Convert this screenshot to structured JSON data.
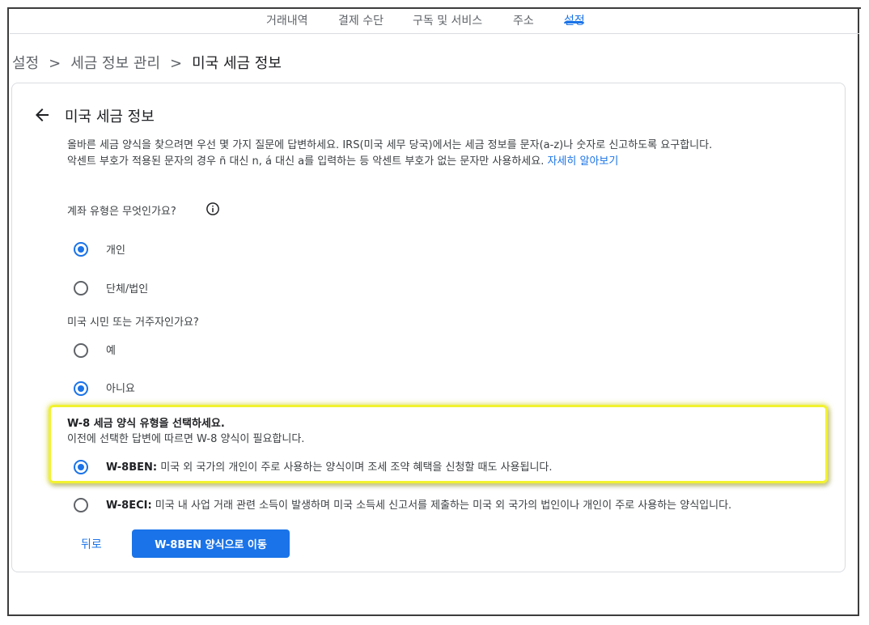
{
  "topnav": {
    "tabs": [
      {
        "label": "거래내역"
      },
      {
        "label": "결제 수단"
      },
      {
        "label": "구독 및 서비스"
      },
      {
        "label": "주소"
      },
      {
        "label": "설정"
      }
    ],
    "active_tab": "설정"
  },
  "breadcrumb": {
    "items": [
      "설정",
      "세금 정보 관리",
      "미국 세금 정보"
    ],
    "separator": ">"
  },
  "card": {
    "title": "미국 세금 정보",
    "intro_line1": "올바른 세금 양식을 찾으려면 우선 몇 가지 질문에 답변하세요. IRS(미국 세무 당국)에서는 세금 정보를 문자(a-z)나 숫자로 신고하도록 요구합니다.",
    "intro_line2": "악센트 부호가 적용된 문자의 경우 ñ 대신 n, á 대신 a를 입력하는 등 악센트 부호가 없는 문자만 사용하세요.",
    "learn_more": "자세히 알아보기"
  },
  "q1": {
    "text": "계좌 유형은 무엇인가요?",
    "options": [
      {
        "label": "개인",
        "checked": true
      },
      {
        "label": "단체/법인",
        "checked": false
      }
    ]
  },
  "q2": {
    "text": "미국 시민 또는 거주자인가요?",
    "options": [
      {
        "label": "예",
        "checked": false
      },
      {
        "label": "아니요",
        "checked": true
      }
    ]
  },
  "w8": {
    "heading": "W-8 세금 양식 유형을 선택하세요.",
    "subtext": "이전에 선택한 답변에 따르면 W-8 양식이 필요합니다.",
    "options": [
      {
        "code": "W-8BEN:",
        "desc": "미국 외 국가의 개인이 주로 사용하는 양식이며 조세 조약 혜택을 신청할 때도 사용됩니다.",
        "checked": true
      },
      {
        "code": "W-8ECI:",
        "desc": "미국 내 사업 거래 관련 소득이 발생하며 미국 소득세 신고서를 제출하는 미국 외 국가의 법인이나 개인이 주로 사용하는 양식입니다.",
        "checked": false
      }
    ]
  },
  "actions": {
    "back_label": "뒤로",
    "primary_label": "W-8BEN 양식으로 이동"
  },
  "colors": {
    "accent": "#1a73e8",
    "highlight": "#f2f230"
  }
}
